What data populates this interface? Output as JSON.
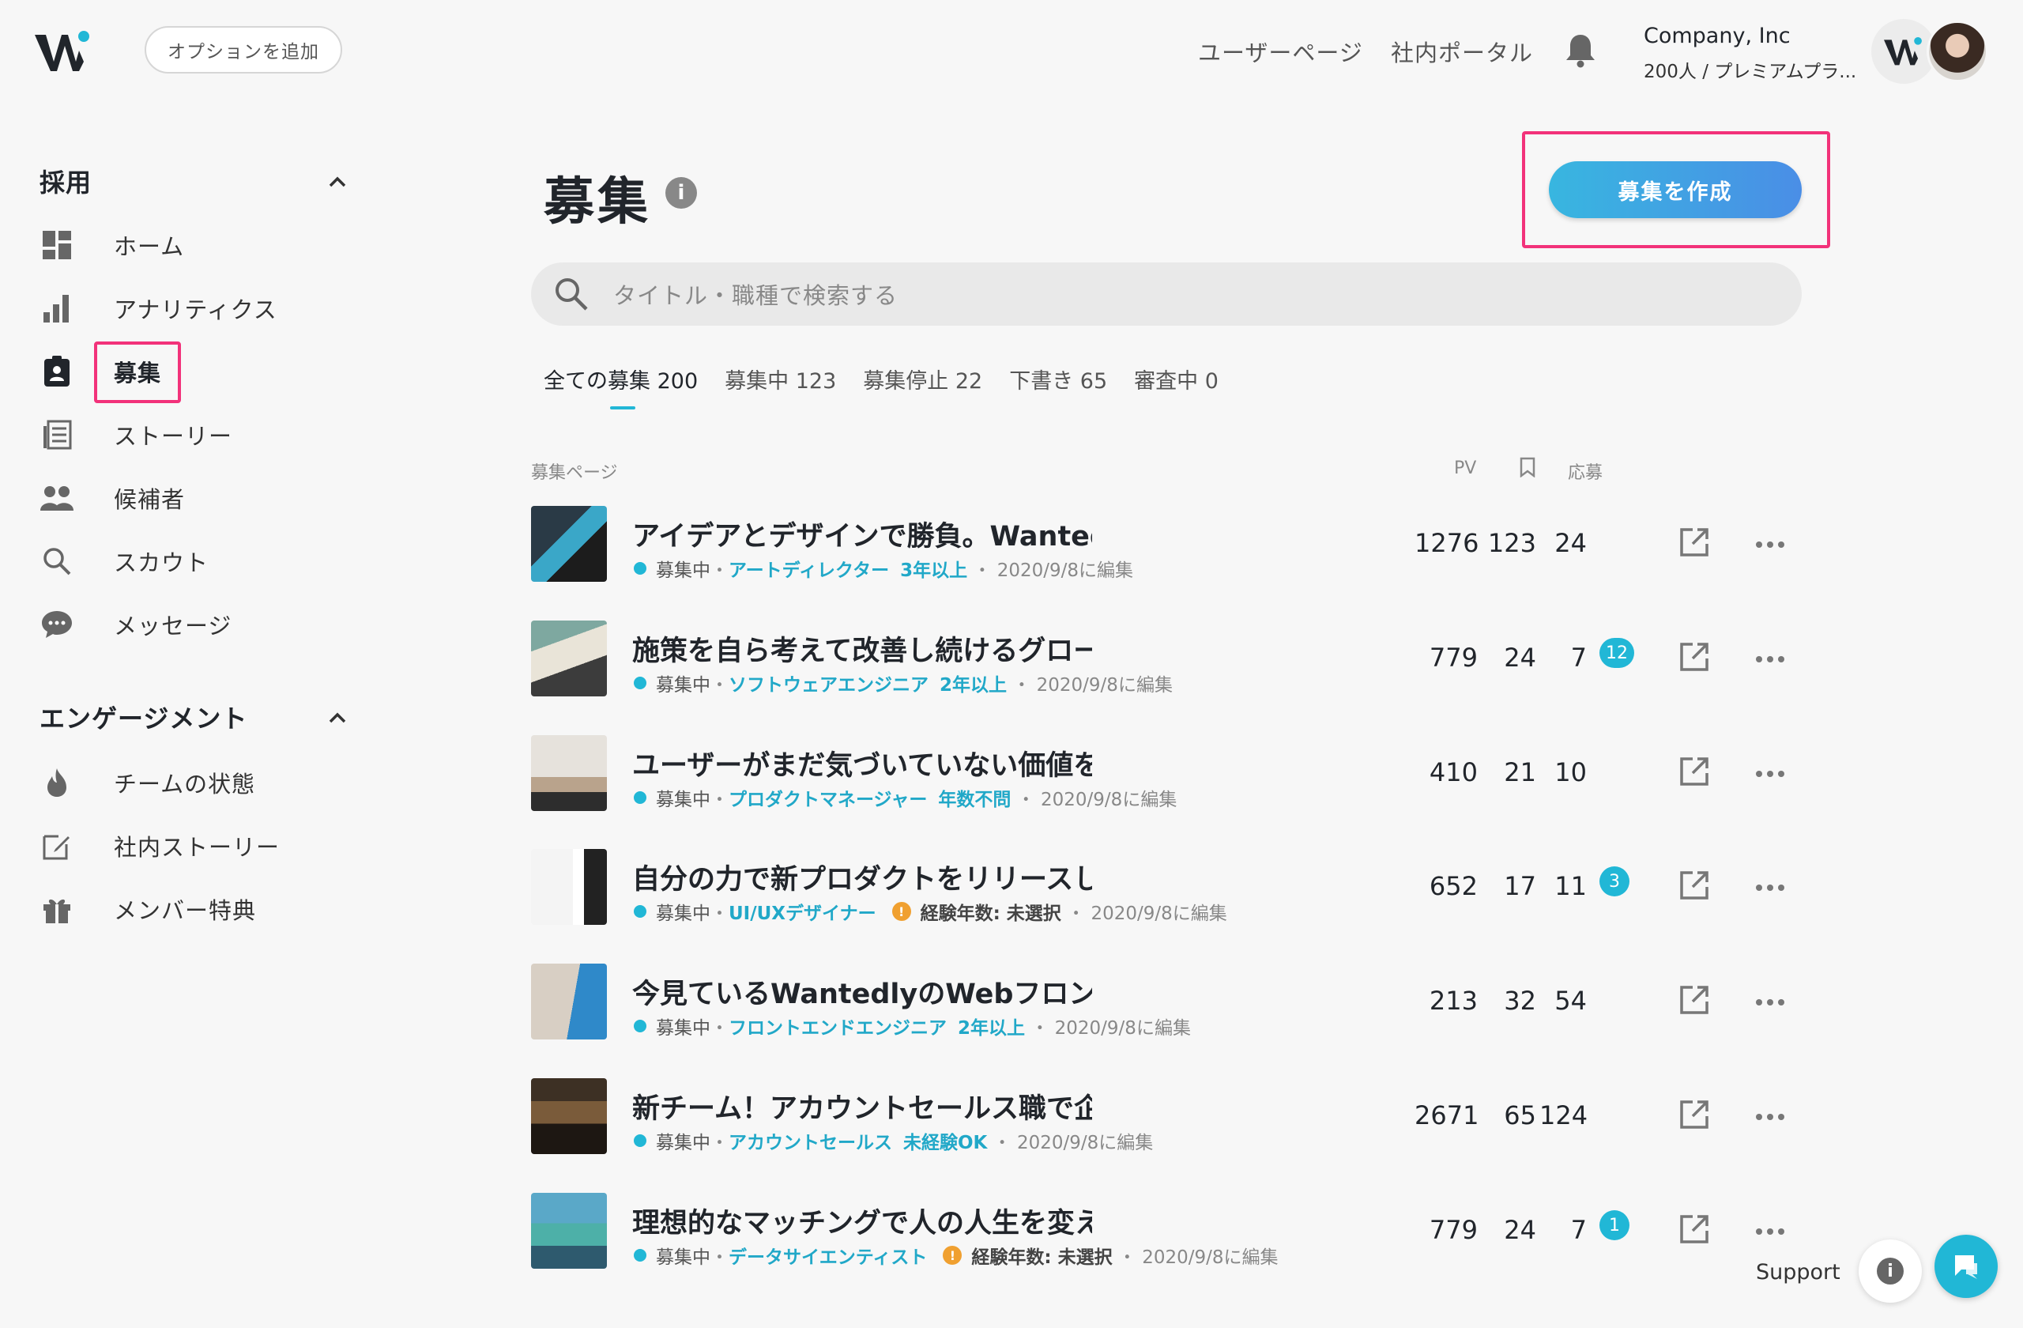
{
  "header": {
    "add_option_label": "オプションを追加",
    "user_page": "ユーザーページ",
    "portal": "社内ポータル",
    "company_name": "Company, Inc",
    "company_plan": "200人 / プレミアムプラ..."
  },
  "sidebar": {
    "section_recruit": "採用",
    "items": [
      {
        "label": "ホーム",
        "icon": "dashboard-icon"
      },
      {
        "label": "アナリティクス",
        "icon": "bar-chart-icon"
      },
      {
        "label": "募集",
        "icon": "badge-icon"
      },
      {
        "label": "ストーリー",
        "icon": "article-icon"
      },
      {
        "label": "候補者",
        "icon": "people-icon"
      },
      {
        "label": "スカウト",
        "icon": "search-icon"
      },
      {
        "label": "メッセージ",
        "icon": "chat-bubble-icon"
      }
    ],
    "section_engage": "エンゲージメント",
    "engage_items": [
      {
        "label": "チームの状態",
        "icon": "flame-icon"
      },
      {
        "label": "社内ストーリー",
        "icon": "edit-icon"
      },
      {
        "label": "メンバー特典",
        "icon": "gift-icon"
      }
    ]
  },
  "main": {
    "title": "募集",
    "create_button": "募集を作成",
    "search_placeholder": "タイトル・職種で検索する",
    "tabs": [
      {
        "label": "全ての募集 200"
      },
      {
        "label": "募集中 123"
      },
      {
        "label": "募集停止 22"
      },
      {
        "label": "下書き 65"
      },
      {
        "label": "審査中 0"
      }
    ],
    "columns": {
      "page": "募集ページ",
      "pv": "PV",
      "bookmark_icon": "bookmark-icon",
      "apply": "応募"
    },
    "rows": [
      {
        "title": "アイデアとデザインで勝負。Wantedyのアートディレクター募集",
        "status": "募集中",
        "role": "アートディレクター",
        "exp": "3年以上",
        "edited": "2020/9/8に編集",
        "pv": "1276",
        "bookmarks": "123",
        "applies": "24",
        "badge": ""
      },
      {
        "title": "施策を自ら考えて改善し続けるグロースエンジニアWanted",
        "status": "募集中",
        "role": "ソフトウェアエンジニア",
        "exp": "2年以上",
        "edited": "2020/9/8に編集",
        "pv": "779",
        "bookmarks": "24",
        "applies": "7",
        "badge": "12"
      },
      {
        "title": "ユーザーがまだ気づいていない価値を生み出すプロダクトマネージャー",
        "status": "募集中",
        "role": "プロダクトマネージャー",
        "exp": "年数不問",
        "edited": "2020/9/8に編集",
        "pv": "410",
        "bookmarks": "21",
        "applies": "10",
        "badge": ""
      },
      {
        "title": "自分の力で新プロダクトをリリースしたいUI/UXデザイナーW",
        "status": "募集中",
        "role": "UI/UXデザイナー",
        "exp": "経験年数: 未選択",
        "edited": "2020/9/8に編集",
        "pv": "652",
        "bookmarks": "17",
        "applies": "11",
        "badge": "3"
      },
      {
        "title": "今見ているWantedlyのWebフロントエンドをもっと良くしませんか",
        "status": "募集中",
        "role": "フロントエンドエンジニア",
        "exp": "2年以上",
        "edited": "2020/9/8に編集",
        "pv": "213",
        "bookmarks": "32",
        "applies": "54",
        "badge": ""
      },
      {
        "title": "新チーム！アカウントセールス職で企業の採用課題を解決しませんか",
        "status": "募集中",
        "role": "アカウントセールス",
        "exp": "未経験OK",
        "edited": "2020/9/8に編集",
        "pv": "2671",
        "bookmarks": "65",
        "applies": "124",
        "badge": ""
      },
      {
        "title": "理想的なマッチングで人の人生を変えたいデータサイエンテ...",
        "status": "募集中",
        "role": "データサイエンティスト",
        "exp": "経験年数: 未選択",
        "edited": "2020/9/8に編集",
        "pv": "779",
        "bookmarks": "24",
        "applies": "7",
        "badge": "1"
      }
    ]
  },
  "support": {
    "label": "Support"
  },
  "colors": {
    "accent": "#21b7d6",
    "highlight": "#f2327a",
    "button_gradient_start": "#38b6e0",
    "button_gradient_end": "#4a8ee6"
  }
}
